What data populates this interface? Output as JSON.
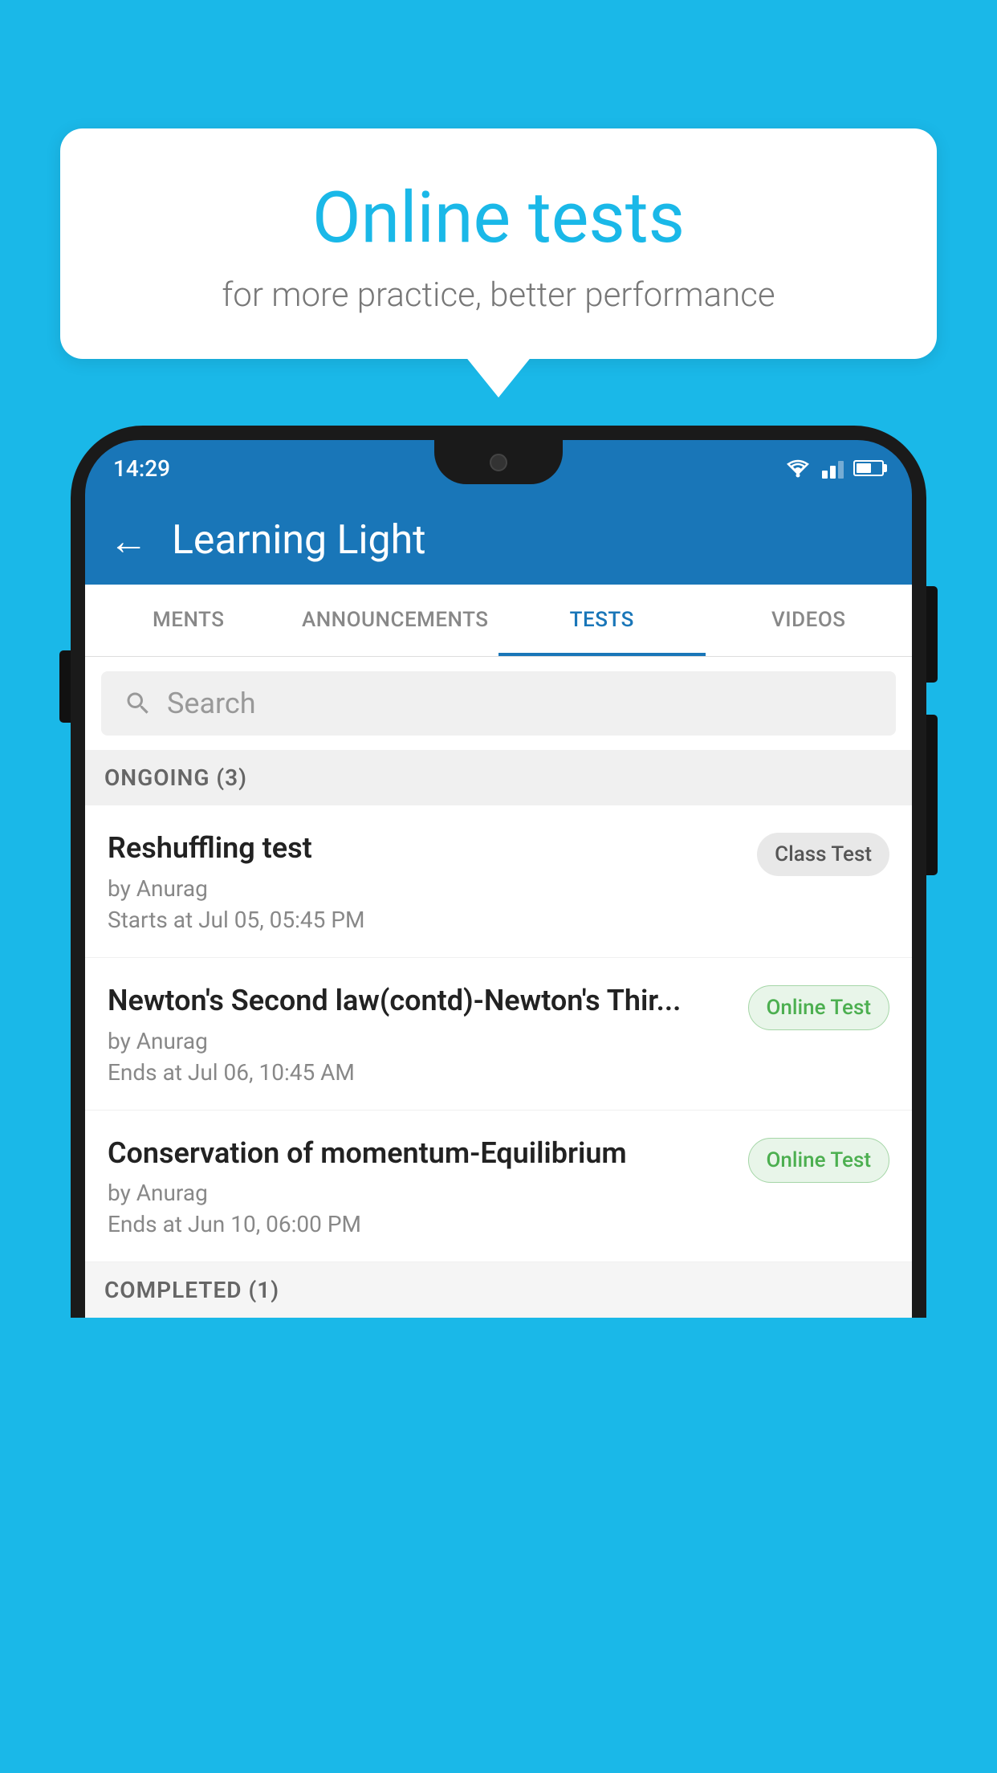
{
  "background_color": "#1ab8e8",
  "bubble": {
    "title": "Online tests",
    "subtitle": "for more practice, better performance"
  },
  "phone": {
    "status_bar": {
      "time": "14:29"
    },
    "app_bar": {
      "title": "Learning Light",
      "back_label": "←"
    },
    "tabs": [
      {
        "label": "MENTS",
        "active": false
      },
      {
        "label": "ANNOUNCEMENTS",
        "active": false
      },
      {
        "label": "TESTS",
        "active": true
      },
      {
        "label": "VIDEOS",
        "active": false
      }
    ],
    "search": {
      "placeholder": "Search"
    },
    "ongoing_section": {
      "header": "ONGOING (3)"
    },
    "tests": [
      {
        "name": "Reshuffling test",
        "author": "by Anurag",
        "time_label": "Starts at",
        "time": "Jul 05, 05:45 PM",
        "badge": "Class Test",
        "badge_type": "class"
      },
      {
        "name": "Newton's Second law(contd)-Newton's Thir...",
        "author": "by Anurag",
        "time_label": "Ends at",
        "time": "Jul 06, 10:45 AM",
        "badge": "Online Test",
        "badge_type": "online"
      },
      {
        "name": "Conservation of momentum-Equilibrium",
        "author": "by Anurag",
        "time_label": "Ends at",
        "time": "Jun 10, 06:00 PM",
        "badge": "Online Test",
        "badge_type": "online"
      }
    ],
    "completed_section": {
      "header": "COMPLETED (1)"
    }
  }
}
